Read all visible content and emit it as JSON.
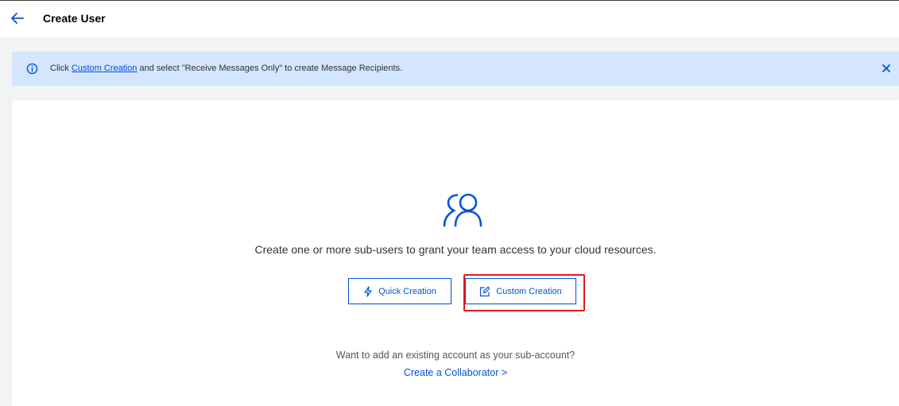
{
  "header": {
    "title": "Create User",
    "back_icon": "arrow-left-icon"
  },
  "notice": {
    "prefix": "Click ",
    "link": "Custom Creation",
    "suffix": " and select \"Receive Messages Only\" to create Message Recipients.",
    "info_icon": "info-icon",
    "close_icon": "close-icon"
  },
  "main": {
    "icon": "users-icon",
    "description": "Create one or more sub-users to grant your team access to your cloud resources.",
    "quick_creation_label": "Quick Creation",
    "custom_creation_label": "Custom Creation",
    "existing_account_text": "Want to add an existing account as your sub-account?",
    "collaborator_link": "Create a Collaborator >"
  },
  "colors": {
    "accent": "#0052d9",
    "notice_bg": "#d4e5fe",
    "highlight": "#e4171b"
  }
}
